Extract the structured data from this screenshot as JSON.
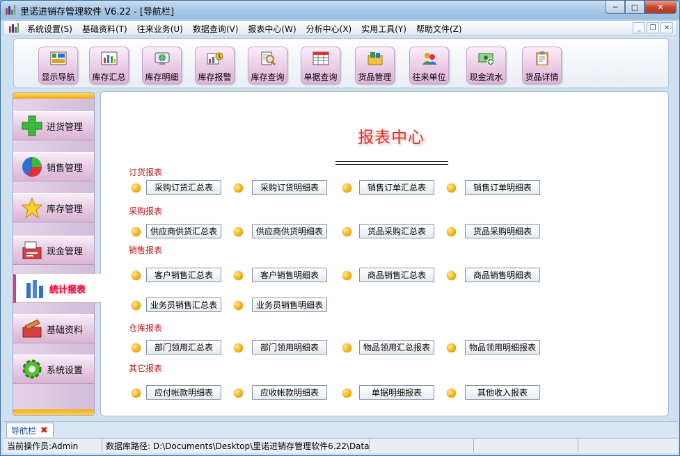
{
  "window": {
    "title": "里诺进销存管理软件 V6.22 - [导航栏]",
    "controls": {
      "minimize": "─",
      "maximize": "□",
      "close": "✕"
    }
  },
  "menubar": {
    "items": [
      "系统设置(S)",
      "基础资料(T)",
      "往来业务(U)",
      "数据查询(V)",
      "报表中心(W)",
      "分析中心(X)",
      "实用工具(Y)",
      "帮助文件(Z)"
    ],
    "mdi": {
      "minimize": "_",
      "restore": "❐",
      "close": "✕"
    }
  },
  "toolbar": {
    "buttons": [
      {
        "label": "显示导航",
        "icon": "navigation-grid-icon"
      },
      {
        "label": "库存汇总",
        "icon": "bar-chart-icon"
      },
      {
        "label": "库存明细",
        "icon": "globe-monitor-icon"
      },
      {
        "label": "库存报警",
        "icon": "alarm-chart-icon"
      },
      {
        "label": "库存查询",
        "icon": "magnifier-document-icon"
      },
      {
        "label": "单据查询",
        "icon": "table-form-icon"
      },
      {
        "label": "货品管理",
        "icon": "folder-items-icon"
      },
      {
        "label": "往来单位",
        "icon": "people-icon"
      },
      {
        "label": "现金流水",
        "icon": "cash-icon"
      },
      {
        "label": "货品详情",
        "icon": "clipboard-icon"
      }
    ]
  },
  "sidebar": {
    "items": [
      {
        "label": "进货管理",
        "icon": "green-plus-icon",
        "active": false
      },
      {
        "label": "销售管理",
        "icon": "pie-chart-icon",
        "active": false
      },
      {
        "label": "库存管理",
        "icon": "star-icon",
        "active": false
      },
      {
        "label": "现金管理",
        "icon": "cash-register-icon",
        "active": false
      },
      {
        "label": "统计报表",
        "icon": "bar-stats-icon",
        "active": true
      },
      {
        "label": "基础资料",
        "icon": "toolbox-icon",
        "active": false
      },
      {
        "label": "系统设置",
        "icon": "gear-icon",
        "active": false
      }
    ]
  },
  "main": {
    "title": "报表中心",
    "sections": [
      {
        "label": "订货报表",
        "rows": [
          [
            "采购订货汇总表",
            "采购订货明细表",
            "销售订单汇总表",
            "销售订单明细表"
          ]
        ]
      },
      {
        "label": "采购报表",
        "rows": [
          [
            "供应商供货汇总表",
            "供应商供货明细表",
            "货品采购汇总表",
            "货品采购明细表"
          ]
        ]
      },
      {
        "label": "销售报表",
        "rows": [
          [
            "客户销售汇总表",
            "客户销售明细表",
            "商品销售汇总表",
            "商品销售明细表"
          ],
          [
            "业务员销售汇总表",
            "业务员销售明细表"
          ]
        ]
      },
      {
        "label": "仓库报表",
        "rows": [
          [
            "部门领用汇总表",
            "部门领用明细表",
            "物品领用汇总报表",
            "物品领用明细报表"
          ]
        ]
      },
      {
        "label": "其它报表",
        "rows": [
          [
            "应付帐款明细表",
            "应收帐款明细表",
            "单据明细报表",
            "其他收入报表"
          ]
        ]
      }
    ]
  },
  "tabbar": {
    "tab_label": "导航栏",
    "close": "✖"
  },
  "status": {
    "operator": "当前操作员:Admin",
    "db_path": "数据库路径: D:\\Documents\\Desktop\\里诺进销存管理软件6.22\\Data\\"
  }
}
